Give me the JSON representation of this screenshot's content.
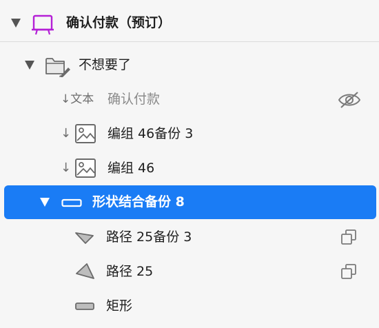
{
  "layers": {
    "artboard": {
      "label": "确认付款（预订）"
    },
    "folder": {
      "label": "不想要了"
    },
    "text_layer": {
      "prefix": "↓文本",
      "label": "确认付款"
    },
    "group_copy": {
      "label": "编组 46备份 3"
    },
    "group": {
      "label": "编组 46"
    },
    "shape_combo": {
      "label": "形状结合备份 8"
    },
    "path_copy": {
      "label": "路径 25备份 3"
    },
    "path": {
      "label": "路径 25"
    },
    "rect": {
      "label": "矩形"
    }
  },
  "icons": {
    "artboard": "artboard-icon",
    "folder": "folder-icon",
    "hidden": "eye-slash-icon",
    "image": "image-icon",
    "mask": "mask-icon",
    "shape": "shape-icon",
    "path": "triangle-path-icon",
    "rect": "rectangle-icon"
  },
  "colors": {
    "accent": "#1a7cf5",
    "artboard_icon": "#b41fd6",
    "background": "#f6f6f6"
  }
}
